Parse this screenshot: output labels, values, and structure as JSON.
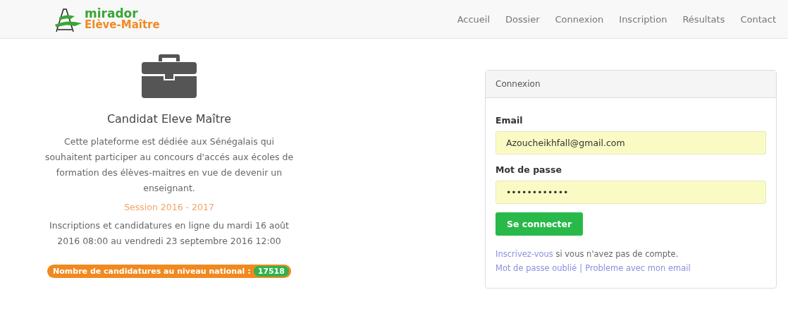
{
  "brand": {
    "name": "mirador",
    "subtitle": "Elève-Maître"
  },
  "nav": [
    {
      "label": "Accueil"
    },
    {
      "label": "Dossier"
    },
    {
      "label": "Connexion"
    },
    {
      "label": "Inscription"
    },
    {
      "label": "Résultats"
    },
    {
      "label": "Contact"
    }
  ],
  "intro": {
    "title": "Candidat Eleve Maître",
    "description": "Cette plateforme est dédiée aux Sénégalais qui souhaitent participer au concours d'accés aux écoles de formation des élèves-maitres en vue de devenir un enseignant.",
    "session": "Session 2016 - 2017",
    "schedule": "Inscriptions et candidatures en ligne du mardi 16 août 2016 08:00 au vendredi 23 septembre 2016 12:00",
    "counter": {
      "label": "Nombre de candidatures au niveau national :",
      "value": "17518"
    }
  },
  "login": {
    "title": "Connexion",
    "fields": [
      {
        "label": "Email",
        "value": "Azoucheikhfall@gmail.com"
      },
      {
        "label": "Mot de passe",
        "value": "••••••••••••"
      }
    ],
    "submit": "Se connecter",
    "register_link": "Inscrivez-vous",
    "register_text": " si vous n'avez pas de compte.",
    "forgot_link": "Mot de passe oublié",
    "separator": "|",
    "problem_link": "Probleme avec mon email"
  }
}
